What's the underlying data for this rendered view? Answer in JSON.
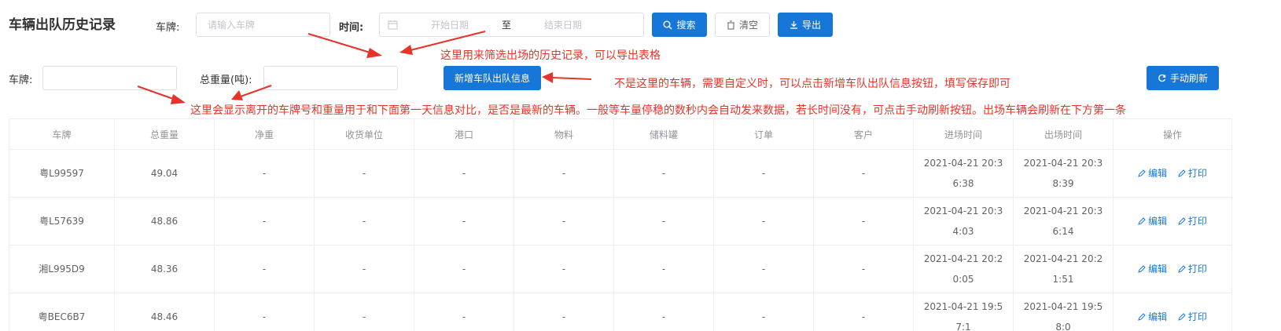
{
  "page": {
    "title": "车辆出队历史记录"
  },
  "filters": {
    "plate_label": "车牌:",
    "plate_placeholder": "请输入车牌",
    "time_label": "时间:",
    "start_placeholder": "开始日期",
    "range_separator": "至",
    "end_placeholder": "结束日期",
    "search_label": "搜索",
    "clear_label": "清空",
    "export_label": "导出"
  },
  "entry": {
    "plate_label": "车牌:",
    "plate_value": "",
    "weight_label": "总重量(吨):",
    "weight_value": "",
    "add_label": "新增车队出队信息",
    "refresh_label": "手动刷新"
  },
  "annotations": {
    "filter_note": "这里用来筛选出场的历史记录，可以导出表格",
    "add_note": "不是这里的车辆，需要自定义时，可以点击新增车队出队信息按钮，填写保存即可",
    "display_note": "这里会显示离开的车牌号和重量用于和下面第一天信息对比，是否是最新的车辆。一般等车量停稳的数秒内会自动发来数据，若长时间没有，可点击手动刷新按钮。出场车辆会刷新在下方第一条"
  },
  "table": {
    "columns": [
      "车牌",
      "总重量",
      "净重",
      "收货单位",
      "港口",
      "物料",
      "储料罐",
      "订单",
      "客户",
      "进场时间",
      "出场时间",
      "操作"
    ],
    "edit_label": "编辑",
    "print_label": "打印",
    "rows": [
      {
        "plate": "粤L99597",
        "gross": "49.04",
        "net": "-",
        "receiver": "-",
        "port": "-",
        "material": "-",
        "tank": "-",
        "order": "-",
        "customer": "-",
        "in_time": "2021-04-21 20:36:38",
        "out_time": "2021-04-21 20:38:39"
      },
      {
        "plate": "粤L57639",
        "gross": "48.86",
        "net": "-",
        "receiver": "-",
        "port": "-",
        "material": "-",
        "tank": "-",
        "order": "-",
        "customer": "-",
        "in_time": "2021-04-21 20:34:03",
        "out_time": "2021-04-21 20:36:14"
      },
      {
        "plate": "湘L995D9",
        "gross": "48.36",
        "net": "-",
        "receiver": "-",
        "port": "-",
        "material": "-",
        "tank": "-",
        "order": "-",
        "customer": "-",
        "in_time": "2021-04-21 20:20:05",
        "out_time": "2021-04-21 20:21:51"
      },
      {
        "plate": "粤BEC6B7",
        "gross": "48.46",
        "net": "-",
        "receiver": "-",
        "port": "-",
        "material": "-",
        "tank": "-",
        "order": "-",
        "customer": "-",
        "in_time": "2021-04-21 19:57:1",
        "out_time": "2021-04-21 19:58:0"
      }
    ]
  },
  "colors": {
    "primary": "#1677d9",
    "annotation": "#e8332a"
  }
}
